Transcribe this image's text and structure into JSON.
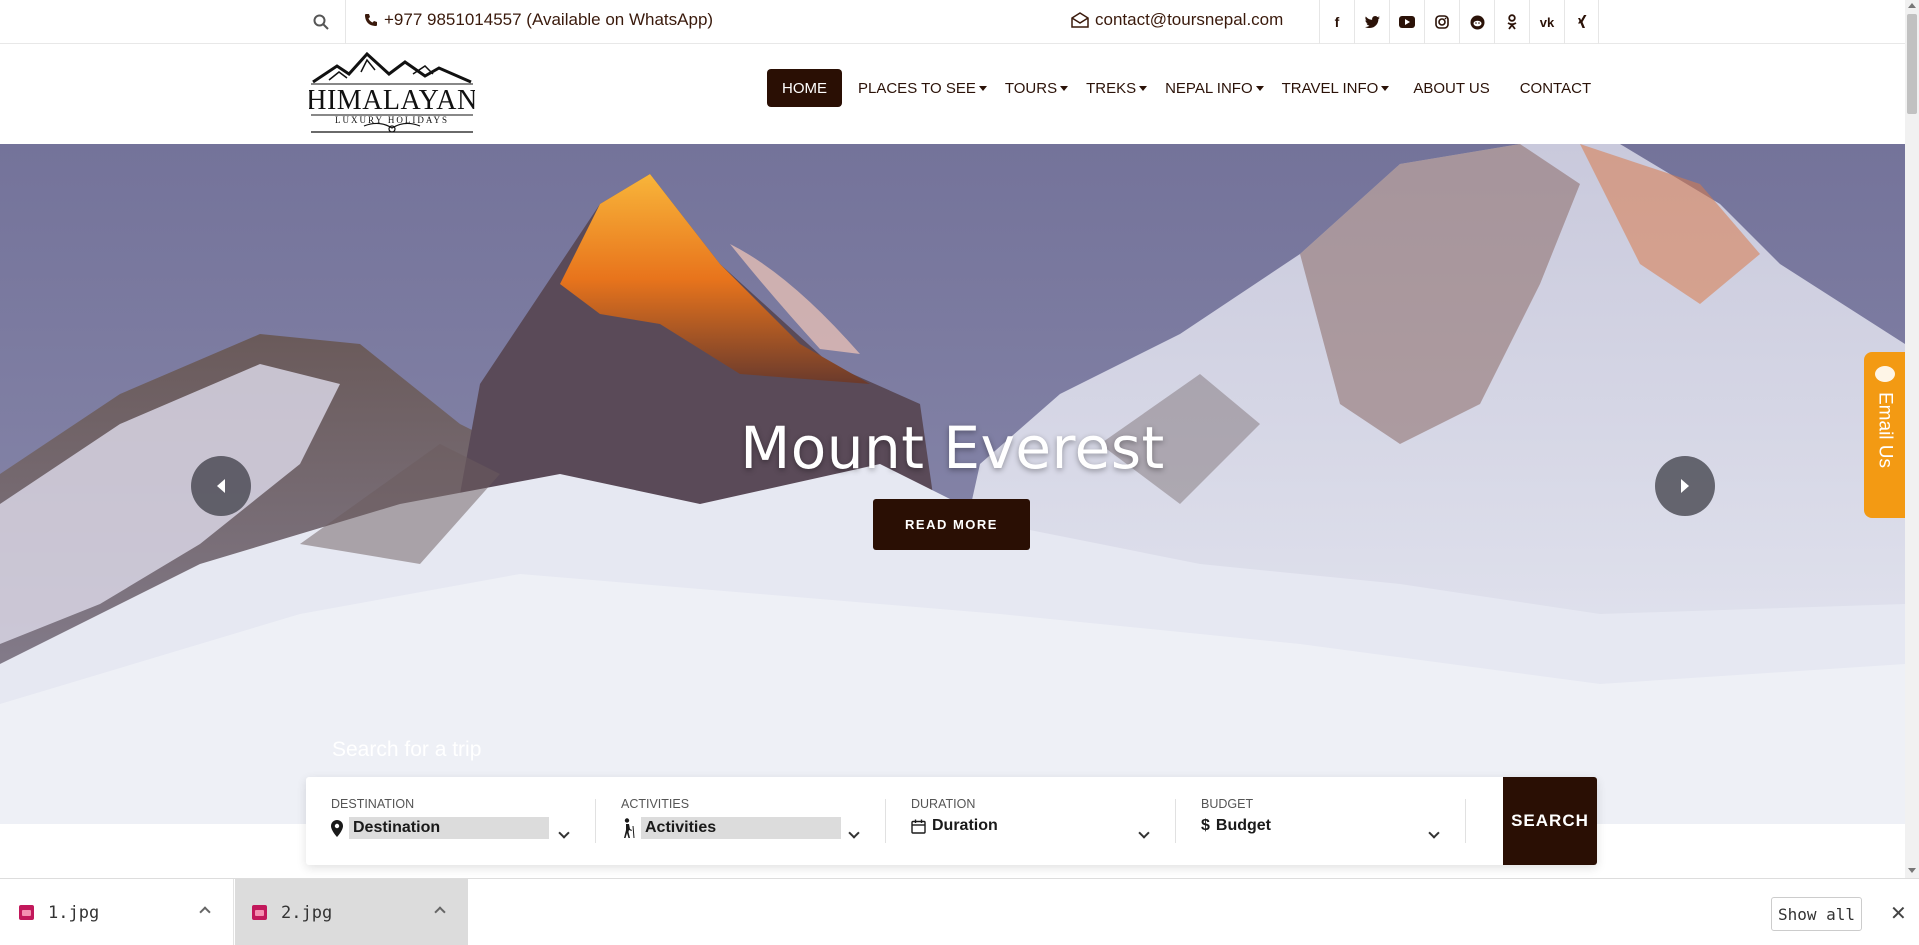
{
  "topbar": {
    "phone": "+977 9851014557 (Available on WhatsApp)",
    "email": "contact@toursnepal.com",
    "social": [
      "facebook-icon",
      "twitter-icon",
      "youtube-icon",
      "instagram-icon",
      "reddit-icon",
      "odnoklassniki-icon",
      "vk-icon",
      "xing-icon"
    ]
  },
  "logo": {
    "name": "HIMALAYAN",
    "tagline": "LUXURY HOLIDAYS"
  },
  "nav": {
    "items": [
      {
        "label": "HOME",
        "active": true
      },
      {
        "label": "PLACES TO SEE",
        "dropdown": true
      },
      {
        "label": "TOURS",
        "dropdown": true
      },
      {
        "label": "TREKS",
        "dropdown": true
      },
      {
        "label": "NEPAL INFO",
        "dropdown": true
      },
      {
        "label": "TRAVEL INFO",
        "dropdown": true
      },
      {
        "label": "ABOUT US"
      },
      {
        "label": "CONTACT"
      }
    ]
  },
  "hero": {
    "title": "Mount Everest",
    "button": "READ MORE",
    "search_heading": "Search for a trip"
  },
  "side_tab": {
    "label": "Email Us"
  },
  "search": {
    "fields": [
      {
        "label": "DESTINATION",
        "value": "Destination",
        "icon": "map-pin-icon"
      },
      {
        "label": "ACTIVITIES",
        "value": "Activities",
        "icon": "hiker-icon"
      },
      {
        "label": "DURATION",
        "value": "Duration",
        "icon": "calendar-icon"
      },
      {
        "label": "BUDGET",
        "value": "Budget",
        "icon": "dollar-icon"
      }
    ],
    "button": "SEARCH"
  },
  "downloads": {
    "items": [
      {
        "name": "1.jpg"
      },
      {
        "name": "2.jpg"
      }
    ],
    "show_all": "Show all"
  },
  "colors": {
    "brand_dark": "#2a0f04",
    "accent_orange": "#f39a13"
  }
}
